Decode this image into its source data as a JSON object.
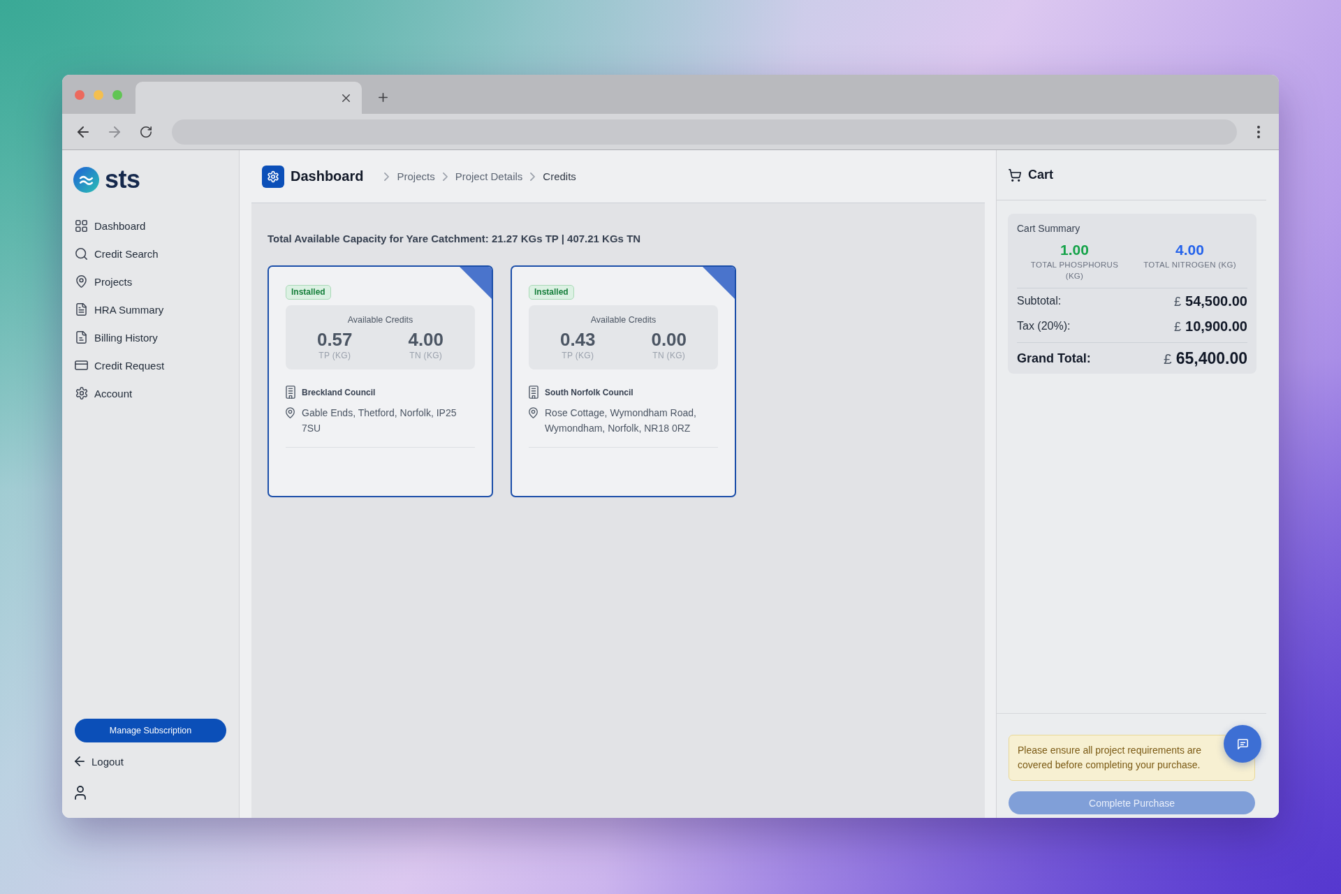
{
  "browser": {
    "back": {
      "disabled": false
    },
    "forward": {
      "disabled": true
    }
  },
  "sidebar": {
    "logo": "sts",
    "items": [
      {
        "label": "Dashboard",
        "selected": false
      },
      {
        "label": "Credit Search",
        "selected": false
      },
      {
        "label": "Projects",
        "selected": false
      },
      {
        "label": "HRA Summary",
        "selected": false
      },
      {
        "label": "Billing History",
        "selected": false
      },
      {
        "label": "Credit Request",
        "selected": false
      },
      {
        "label": "Account",
        "selected": false
      }
    ],
    "manage_button": "Manage Subscription",
    "logout": "Logout"
  },
  "header": {
    "title": "Dashboard",
    "breadcrumbs": [
      {
        "label": "Projects",
        "current": false
      },
      {
        "label": "Project Details",
        "current": false
      },
      {
        "label": "Credits",
        "current": true
      }
    ]
  },
  "capacity_summary": "Total Available Capacity for Yare Catchment: 21.27 KGs TP | 407.21 KGs TN",
  "project_cards": [
    {
      "selected": true,
      "status": "Installed",
      "credits_title": "Available Credits",
      "credits": [
        {
          "value": "0.57",
          "unit": "TP (KG)"
        },
        {
          "value": "4.00",
          "unit": "TN (KG)"
        }
      ],
      "council": "Breckland Council",
      "address": "Gable Ends, Thetford, Norfolk, IP25 7SU"
    },
    {
      "selected": true,
      "status": "Installed",
      "credits_title": "Available Credits",
      "credits": [
        {
          "value": "0.43",
          "unit": "TP (KG)"
        },
        {
          "value": "0.00",
          "unit": "TN (KG)"
        }
      ],
      "council": "South Norfolk Council",
      "address": "Rose Cottage, Wymondham Road, Wymondham, Norfolk, NR18 0RZ"
    }
  ],
  "cart": {
    "title": "Cart",
    "summary": {
      "title": "Cart Summary",
      "totals": [
        {
          "value": "1.00",
          "label": "TOTAL PHOSPHORUS (KG)",
          "color": "#16a34a"
        },
        {
          "value": "4.00",
          "label": "TOTAL NITROGEN (KG)",
          "color": "#2563eb"
        }
      ],
      "rows": [
        {
          "kind": "line",
          "label": "Subtotal:",
          "currency": "£",
          "amount": "54,500.00"
        },
        {
          "kind": "line",
          "label": "Tax (20%):",
          "currency": "£",
          "amount": "10,900.00"
        },
        {
          "kind": "total",
          "label": "Grand Total:",
          "currency": "£",
          "amount": "65,400.00"
        }
      ]
    },
    "notice": "Please ensure all project requirements are covered before completing your purchase.",
    "purchase_button": {
      "label": "Complete Purchase",
      "disabled": true
    }
  }
}
